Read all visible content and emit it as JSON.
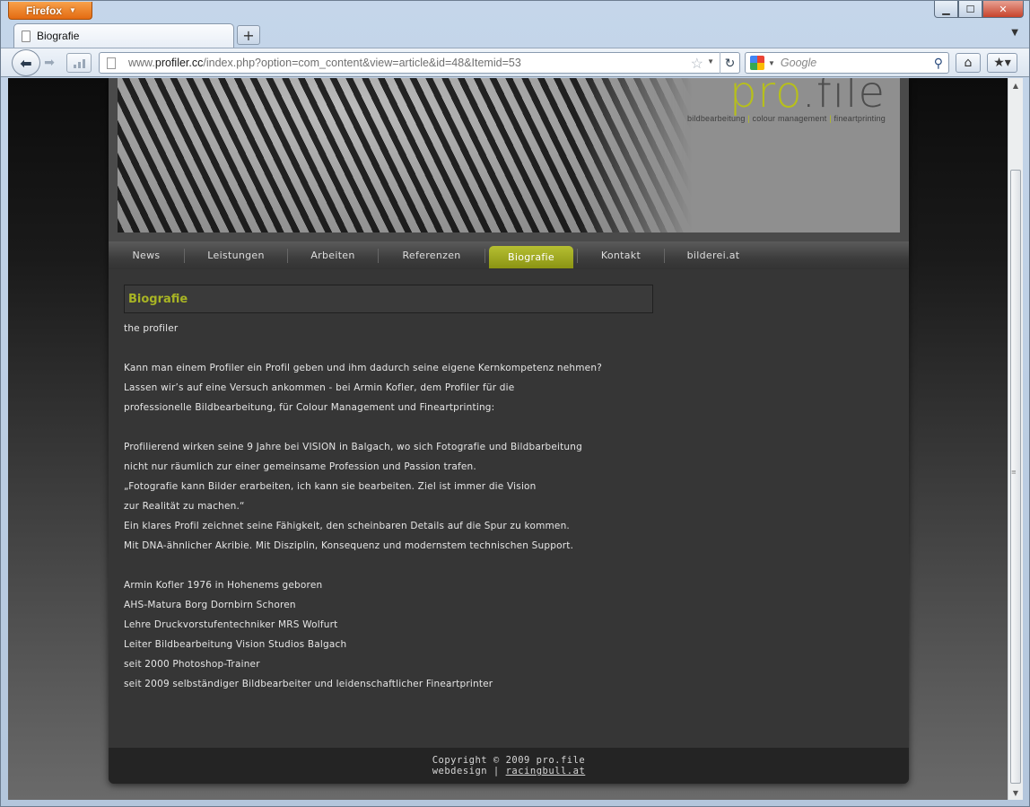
{
  "browser": {
    "menu_button": "Firefox",
    "tab_title": "Biografie",
    "url_prefix": "www.",
    "url_host": "profiler.cc",
    "url_path": "/index.php?option=com_content&view=article&id=48&Itemid=53",
    "search_placeholder": "Google"
  },
  "logo": {
    "pro": "pr",
    "o": "o",
    "file": ".file",
    "tagline_1": "bildbearbeitung",
    "tagline_2": "colour management",
    "tagline_3": "fineartprinting"
  },
  "menu": {
    "items": [
      {
        "label": "News"
      },
      {
        "label": "Leistungen"
      },
      {
        "label": "Arbeiten"
      },
      {
        "label": "Referenzen"
      },
      {
        "label": "Biografie"
      },
      {
        "label": "Kontakt"
      },
      {
        "label": "bilderei.at"
      }
    ]
  },
  "article": {
    "title": "Biografie",
    "lines": [
      "the profiler",
      "",
      "Kann man einem Profiler ein Profil geben und ihm dadurch seine eigene Kernkompetenz nehmen?",
      "Lassen wir’s auf eine Versuch ankommen - bei Armin Kofler, dem Profiler für die",
      "professionelle Bildbearbeitung, für Colour Management und Fineartprinting:",
      "",
      "Profilierend wirken seine 9 Jahre bei VISION in Balgach, wo sich Fotografie und Bildbarbeitung",
      "nicht nur räumlich zur einer gemeinsame Profession und Passion trafen.",
      "„Fotografie kann Bilder erarbeiten, ich kann sie bearbeiten. Ziel ist immer die Vision",
      "zur Realität zu machen.“",
      "Ein klares Profil zeichnet seine Fähigkeit, den scheinbaren Details auf die Spur zu kommen.",
      "Mit DNA-ähnlicher Akribie. Mit Disziplin, Konsequenz und modernstem technischen Support.",
      "",
      "Armin Kofler 1976 in Hohenems geboren",
      "AHS-Matura Borg Dornbirn Schoren",
      "Lehre Druckvorstufentechniker MRS Wolfurt",
      "Leiter Bildbearbeitung Vision Studios Balgach",
      "seit 2000 Photoshop-Trainer",
      "seit 2009 selbständiger Bildbearbeiter und leidenschaftlicher Fineartprinter"
    ]
  },
  "footer": {
    "copyright": "Copyright © 2009 pro.file",
    "webdesign": "webdesign |",
    "link": "racingbull.at"
  },
  "colors": {
    "accent": "#a8b424",
    "page_bg": "#363636"
  }
}
